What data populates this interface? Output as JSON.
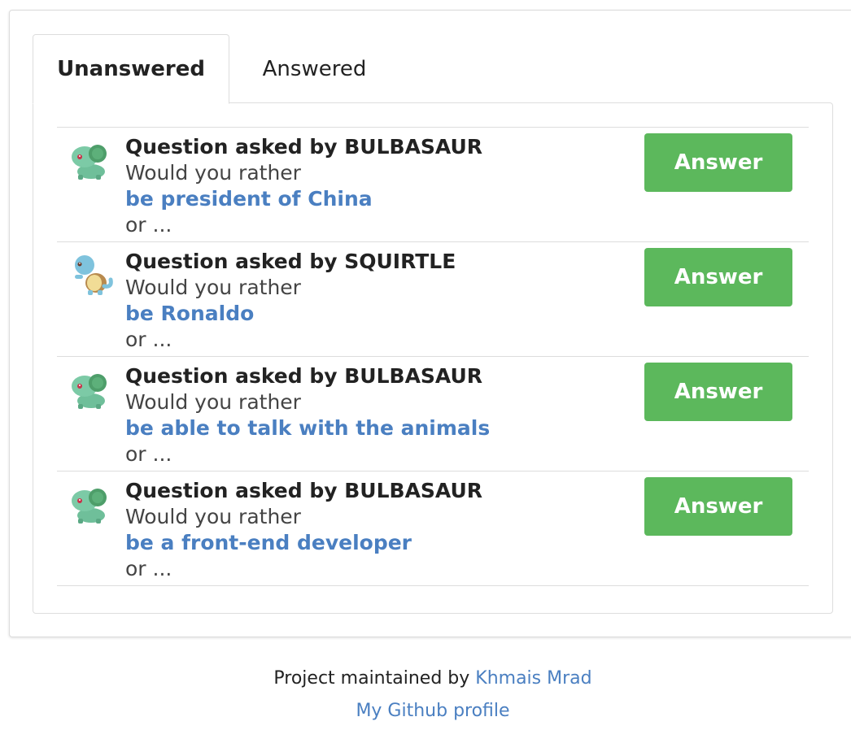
{
  "tabs": {
    "active_label": "Unanswered",
    "inactive_label": "Answered"
  },
  "questions": [
    {
      "author_text": "Question asked by BULBASAUR",
      "avatar": "bulbasaur",
      "prompt": "Would you rather",
      "option": "be president of China",
      "or_text": "or ...",
      "button_label": "Answer"
    },
    {
      "author_text": "Question asked by SQUIRTLE",
      "avatar": "squirtle",
      "prompt": "Would you rather",
      "option": "be Ronaldo",
      "or_text": "or ...",
      "button_label": "Answer"
    },
    {
      "author_text": "Question asked by BULBASAUR",
      "avatar": "bulbasaur",
      "prompt": "Would you rather",
      "option": "be able to talk with the animals",
      "or_text": "or ...",
      "button_label": "Answer"
    },
    {
      "author_text": "Question asked by BULBASAUR",
      "avatar": "bulbasaur",
      "prompt": "Would you rather",
      "option": "be a front-end developer",
      "or_text": "or ...",
      "button_label": "Answer"
    }
  ],
  "footer": {
    "maintained_prefix": "Project maintained by",
    "author_link": "Khmais Mrad",
    "github_link": "My Github profile"
  },
  "colors": {
    "answer_button": "#5cb85c",
    "link": "#4a7fc1"
  }
}
